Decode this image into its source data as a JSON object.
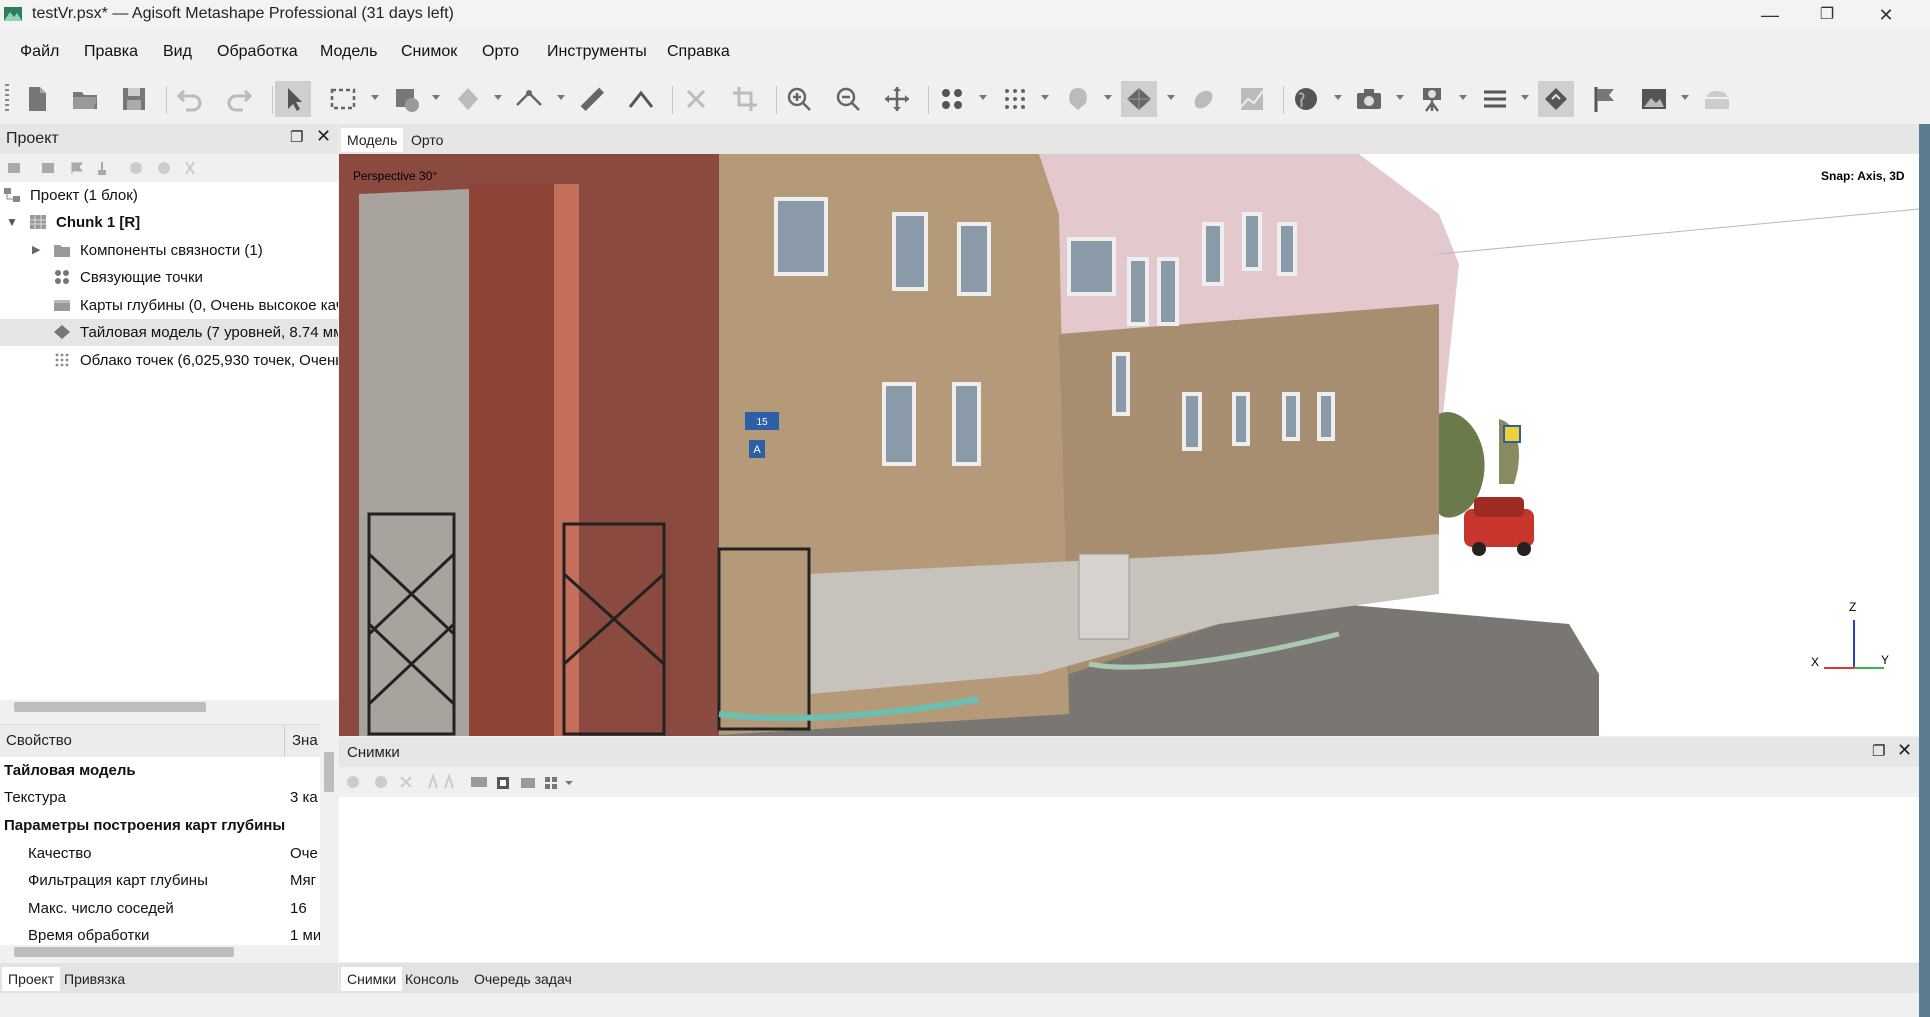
{
  "window": {
    "title": "testVr.psx* — Agisoft Metashape Professional (31 days left)",
    "minimize_label": "—",
    "maximize_label": "❐",
    "close_label": "✕"
  },
  "menu": [
    "Файл",
    "Правка",
    "Вид",
    "Обработка",
    "Модель",
    "Снимок",
    "Орто",
    "Инструменты",
    "Справка"
  ],
  "toolbar": {
    "icons": [
      "new-document-icon",
      "open-folder-icon",
      "save-icon",
      "undo-icon",
      "redo-icon",
      "pointer-icon",
      "rect-select-icon",
      "select-dropdown-icon",
      "tiled-shading-icon",
      "ruler-line-icon",
      "ruler-icon",
      "polyline-icon",
      "delete-icon",
      "crop-icon",
      "zoom-in-icon",
      "zoom-out-icon",
      "move-icon",
      "points-grid-icon",
      "dense-points-icon",
      "shading-icon",
      "tiled-model-icon",
      "texture-icon",
      "dem-icon",
      "globe-icon",
      "camera-icon",
      "camera-stand-icon",
      "menu-lines-icon",
      "diamond-hand-icon",
      "flag-icon",
      "image-icon",
      "layers-icon"
    ]
  },
  "project_panel": {
    "title": "Проект",
    "tree": [
      {
        "label": "Проект (1 блок)",
        "bold": false
      },
      {
        "label": "Chunk 1 [R]",
        "bold": true
      },
      {
        "label": "Компоненты связности (1)",
        "bold": false
      },
      {
        "label": "Связующие точки",
        "bold": false
      },
      {
        "label": "Карты глубины (0, Очень высокое кач",
        "bold": false
      },
      {
        "label": "Тайловая модель (7 уровней, 8.74 мм",
        "bold": false
      },
      {
        "label": "Облако точек (6,025,930 точек, Очень",
        "bold": false
      }
    ]
  },
  "properties": {
    "header_key": "Свойство",
    "header_value": "Зна",
    "rows": [
      {
        "key": "Тайловая модель",
        "value": "",
        "section": true
      },
      {
        "key": "Текстура",
        "value": "3 ка",
        "section": false
      },
      {
        "key": "Параметры построения карт глубины",
        "value": "",
        "section": true
      },
      {
        "key": "Качество",
        "value": "Оче",
        "section": false
      },
      {
        "key": "Фильтрация карт глубины",
        "value": "Мяг",
        "section": false
      },
      {
        "key": "Макс. число соседей",
        "value": "16",
        "section": false
      },
      {
        "key": "Время обработки",
        "value": "1 ми",
        "section": false
      }
    ]
  },
  "left_tabs": [
    "Проект",
    "Привязка"
  ],
  "view_tabs": [
    "Модель",
    "Орто"
  ],
  "viewport": {
    "perspective_label": "Perspective 30°",
    "snap_label": "Snap: Axis, 3D",
    "axis_x": "X",
    "axis_y": "Y",
    "axis_z": "Z",
    "sign_number": "15",
    "sign_letter": "A"
  },
  "photos_panel": {
    "title": "Снимки"
  },
  "bottom_tabs": [
    "Снимки",
    "Консоль",
    "Очередь задач"
  ]
}
